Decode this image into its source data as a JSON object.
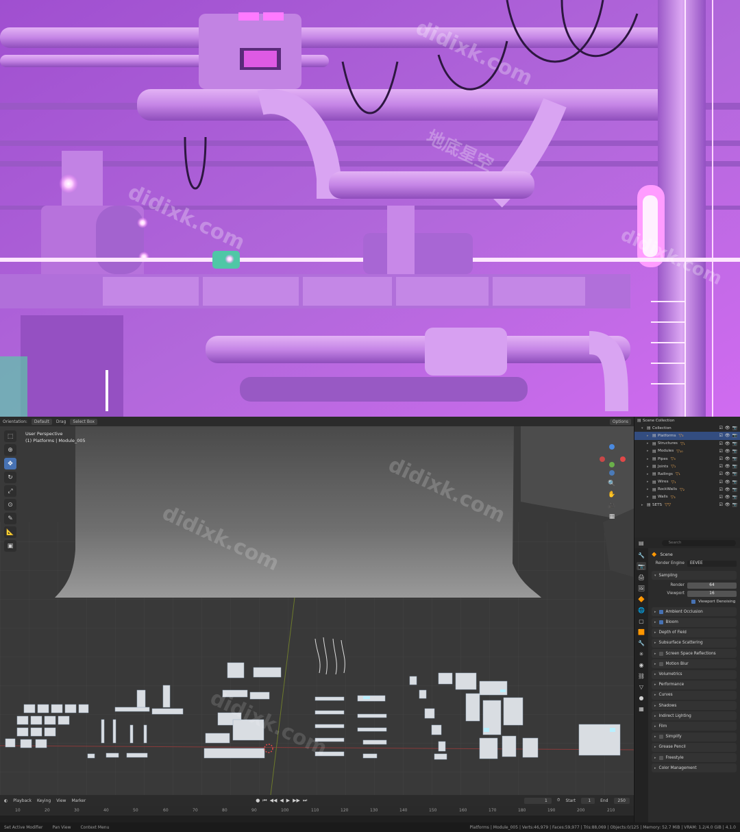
{
  "watermark": {
    "text": "didixk.com",
    "cjk": "地底星空"
  },
  "colors": {
    "neon_magenta": "#e86cff",
    "scene_purple": "#b36ad8",
    "accent_blue": "#4772b3",
    "object_orange": "#e0a050"
  },
  "viewport": {
    "header": {
      "orientation_label": "Orientation:",
      "orientation_value": "Default",
      "drag_label": "Drag",
      "drag_value": "Select Box",
      "options_label": "Options"
    },
    "info_line1": "User Perspective",
    "info_line2": "(1) Platforms | Module_005",
    "tools": [
      "select-box-tool",
      "cursor-tool",
      "move-tool",
      "rotate-tool",
      "scale-tool",
      "transform-tool",
      "annotate-tool",
      "measure-tool",
      "add-cube-tool"
    ]
  },
  "timeline": {
    "menu": [
      "Playback",
      "Keying",
      "View",
      "Marker"
    ],
    "current_frame": "1",
    "start_label": "Start",
    "start_value": "1",
    "end_label": "End",
    "end_value": "250",
    "ruler": [
      "10",
      "20",
      "30",
      "40",
      "50",
      "60",
      "70",
      "80",
      "90",
      "100",
      "110",
      "120",
      "130",
      "140",
      "150",
      "160",
      "170",
      "180",
      "190",
      "200",
      "210"
    ]
  },
  "status_bar": {
    "left": [
      "Set Active Modifier",
      "Pan View",
      "Context Menu"
    ],
    "right": "Platforms | Module_005 | Verts:46,979 | Faces:59,977 | Tris:88,069 | Objects:0/125 | Memory: 52.7 MiB | VRAM: 1.2/4.0 GiB | 4.1.0"
  },
  "outliner": {
    "title": "Scene Collection",
    "rows": [
      {
        "label": "Collection",
        "indent": 1,
        "selected": false,
        "tag": ""
      },
      {
        "label": "Platforms",
        "indent": 2,
        "selected": true,
        "tag": "▽₃"
      },
      {
        "label": "Structures",
        "indent": 2,
        "selected": false,
        "tag": "▽₁"
      },
      {
        "label": "Modules",
        "indent": 2,
        "selected": false,
        "tag": "▽₁₀"
      },
      {
        "label": "Pipes",
        "indent": 2,
        "selected": false,
        "tag": "▽₃"
      },
      {
        "label": "Joints",
        "indent": 2,
        "selected": false,
        "tag": "▽₁"
      },
      {
        "label": "Railings",
        "indent": 2,
        "selected": false,
        "tag": "▽₁"
      },
      {
        "label": "Wires",
        "indent": 2,
        "selected": false,
        "tag": "▽₁"
      },
      {
        "label": "RockWalls",
        "indent": 2,
        "selected": false,
        "tag": "▽₂"
      },
      {
        "label": "Walls",
        "indent": 2,
        "selected": false,
        "tag": "▽₃"
      },
      {
        "label": "SETS",
        "indent": 1,
        "selected": false,
        "tag": "▽▽"
      }
    ]
  },
  "properties": {
    "search_placeholder": "Search",
    "scene_label": "Scene",
    "render_engine_label": "Render Engine",
    "render_engine_value": "EEVEE",
    "sampling_label": "Sampling",
    "render_label": "Render",
    "render_value": "64",
    "viewport_label": "Viewport",
    "viewport_value": "16",
    "viewport_denoising_label": "Viewport Denoising",
    "panels": [
      {
        "label": "Ambient Occlusion",
        "checkbox": "on"
      },
      {
        "label": "Bloom",
        "checkbox": "on"
      },
      {
        "label": "Depth of Field",
        "checkbox": "none"
      },
      {
        "label": "Subsurface Scattering",
        "checkbox": "none"
      },
      {
        "label": "Screen Space Reflections",
        "checkbox": "off"
      },
      {
        "label": "Motion Blur",
        "checkbox": "off"
      },
      {
        "label": "Volumetrics",
        "checkbox": "none"
      },
      {
        "label": "Performance",
        "checkbox": "none"
      },
      {
        "label": "Curves",
        "checkbox": "none"
      },
      {
        "label": "Shadows",
        "checkbox": "none"
      },
      {
        "label": "Indirect Lighting",
        "checkbox": "none"
      },
      {
        "label": "Film",
        "checkbox": "none"
      },
      {
        "label": "Simplify",
        "checkbox": "off"
      },
      {
        "label": "Grease Pencil",
        "checkbox": "none"
      },
      {
        "label": "Freestyle",
        "checkbox": "off"
      },
      {
        "label": "Color Management",
        "checkbox": "none"
      }
    ]
  }
}
